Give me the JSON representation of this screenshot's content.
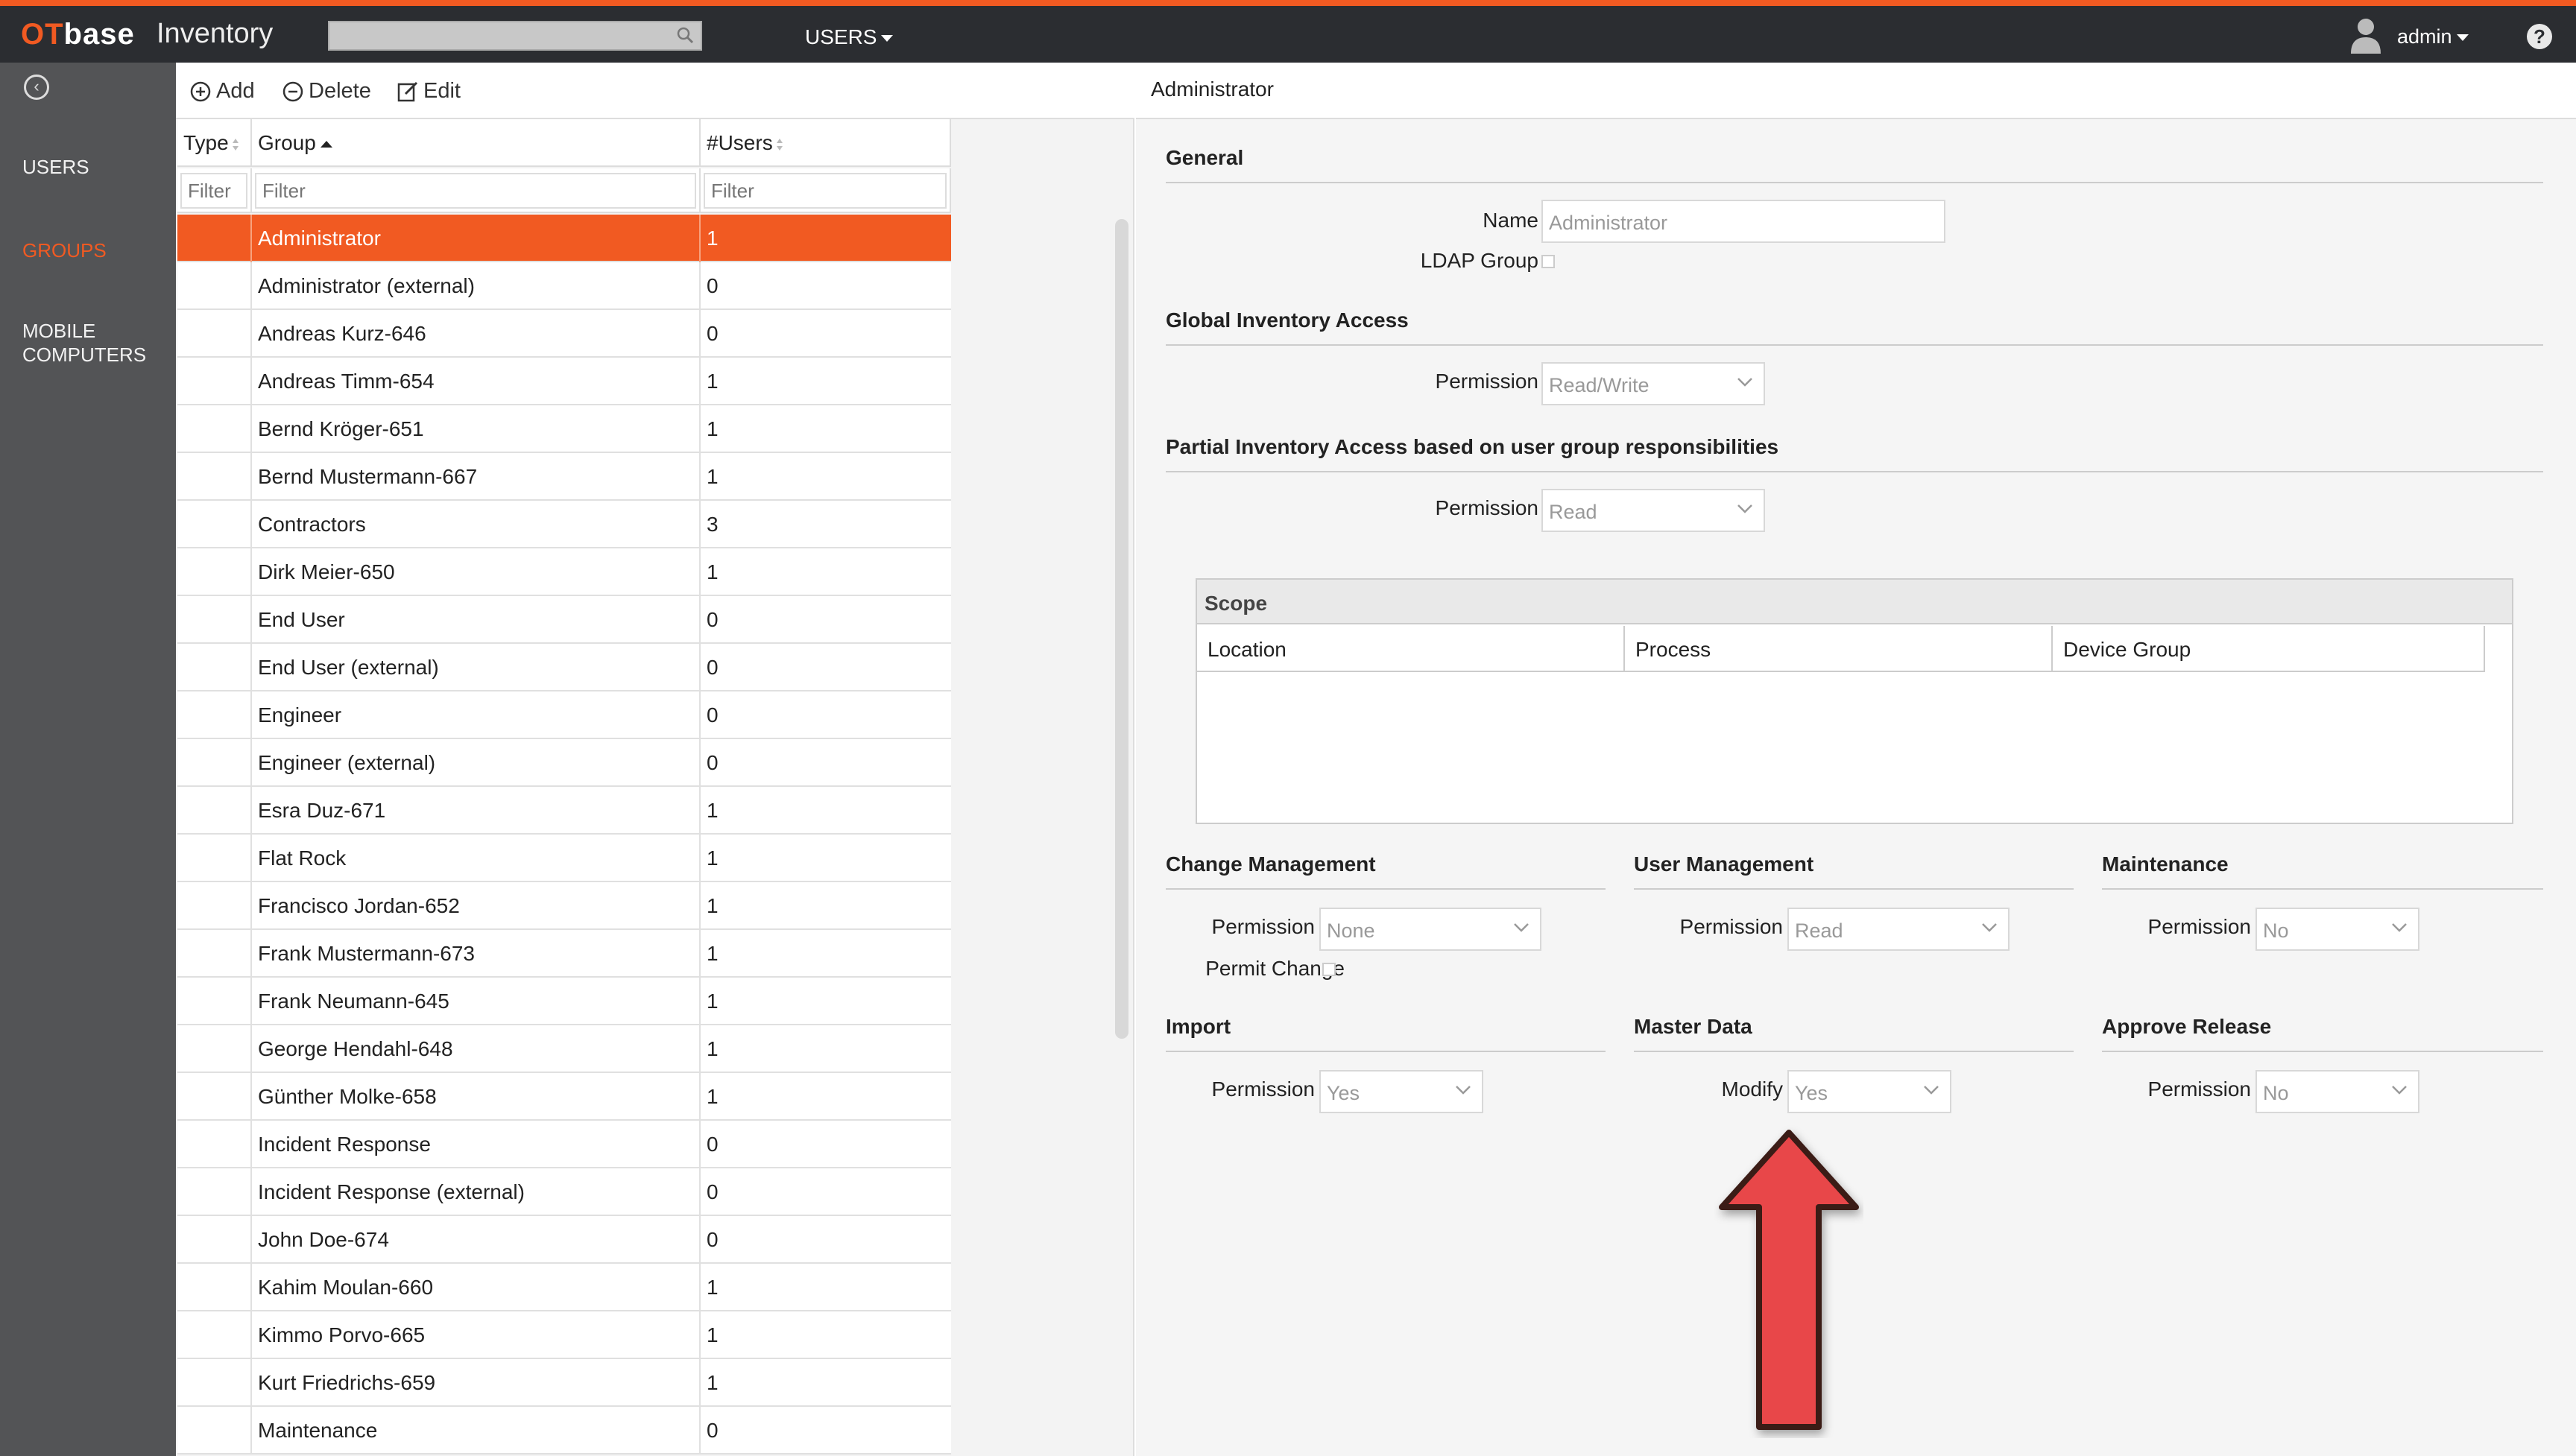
{
  "app": {
    "logo_ot": "OT",
    "logo_base": "base",
    "name": "Inventory"
  },
  "topbar": {
    "users_menu": "USERS",
    "admin_menu": "admin",
    "help": "?"
  },
  "nav": {
    "users": "USERS",
    "groups": "GROUPS",
    "mobile": "MOBILE COMPUTERS"
  },
  "toolbar": {
    "add": "Add",
    "delete": "Delete",
    "edit": "Edit"
  },
  "table": {
    "headers": {
      "type": "Type",
      "group": "Group",
      "users": "#Users"
    },
    "filter_placeholder": "Filter",
    "rows": [
      {
        "group": "Administrator",
        "users": "1"
      },
      {
        "group": "Administrator (external)",
        "users": "0"
      },
      {
        "group": "Andreas Kurz-646",
        "users": "0"
      },
      {
        "group": "Andreas Timm-654",
        "users": "1"
      },
      {
        "group": "Bernd Kröger-651",
        "users": "1"
      },
      {
        "group": "Bernd Mustermann-667",
        "users": "1"
      },
      {
        "group": "Contractors",
        "users": "3"
      },
      {
        "group": "Dirk Meier-650",
        "users": "1"
      },
      {
        "group": "End User",
        "users": "0"
      },
      {
        "group": "End User (external)",
        "users": "0"
      },
      {
        "group": "Engineer",
        "users": "0"
      },
      {
        "group": "Engineer (external)",
        "users": "0"
      },
      {
        "group": "Esra Duz-671",
        "users": "1"
      },
      {
        "group": "Flat Rock",
        "users": "1"
      },
      {
        "group": "Francisco Jordan-652",
        "users": "1"
      },
      {
        "group": "Frank Mustermann-673",
        "users": "1"
      },
      {
        "group": "Frank Neumann-645",
        "users": "1"
      },
      {
        "group": "George Hendahl-648",
        "users": "1"
      },
      {
        "group": "Günther Molke-658",
        "users": "1"
      },
      {
        "group": "Incident Response",
        "users": "0"
      },
      {
        "group": "Incident Response (external)",
        "users": "0"
      },
      {
        "group": "John Doe-674",
        "users": "0"
      },
      {
        "group": "Kahim Moulan-660",
        "users": "1"
      },
      {
        "group": "Kimmo Porvo-665",
        "users": "1"
      },
      {
        "group": "Kurt Friedrichs-659",
        "users": "1"
      },
      {
        "group": "Maintenance",
        "users": "0"
      }
    ]
  },
  "detail": {
    "title": "Administrator",
    "general": {
      "heading": "General",
      "name_label": "Name",
      "name_value": "Administrator",
      "ldap_label": "LDAP Group"
    },
    "global": {
      "heading": "Global Inventory Access",
      "perm_label": "Permission",
      "perm_value": "Read/Write"
    },
    "partial": {
      "heading": "Partial Inventory Access based on user group responsibilities",
      "perm_label": "Permission",
      "perm_value": "Read"
    },
    "scope": {
      "heading": "Scope",
      "col_location": "Location",
      "col_process": "Process",
      "col_device": "Device Group"
    },
    "change": {
      "heading": "Change Management",
      "perm_label": "Permission",
      "perm_value": "None",
      "permit_label": "Permit Change"
    },
    "usermgmt": {
      "heading": "User Management",
      "perm_label": "Permission",
      "perm_value": "Read"
    },
    "maintenance": {
      "heading": "Maintenance",
      "perm_label": "Permission",
      "perm_value": "No"
    },
    "import": {
      "heading": "Import",
      "perm_label": "Permission",
      "perm_value": "Yes"
    },
    "master": {
      "heading": "Master Data",
      "modify_label": "Modify",
      "modify_value": "Yes"
    },
    "approve": {
      "heading": "Approve Release",
      "perm_label": "Permission",
      "perm_value": "No"
    }
  },
  "colors": {
    "accent": "#f15a22",
    "topbar": "#2b2d31",
    "leftnav": "#535456",
    "arrow": "#e8474a"
  },
  "icons": [
    "search-icon",
    "user-avatar-icon",
    "help-icon",
    "back-icon",
    "add-icon",
    "delete-icon",
    "edit-icon",
    "chevron-down-icon",
    "annotation-arrow"
  ]
}
